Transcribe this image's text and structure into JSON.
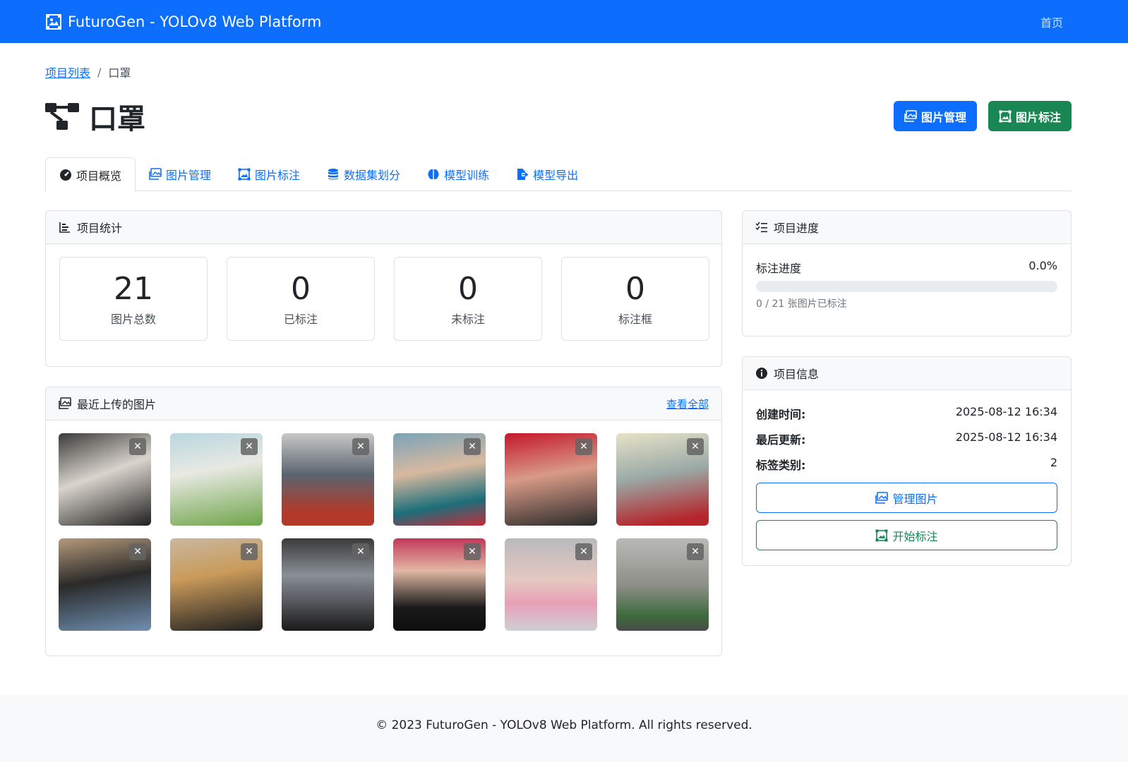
{
  "navbar": {
    "brand": "FuturoGen - YOLOv8 Web Platform",
    "home_link": "首页"
  },
  "breadcrumb": {
    "parent": "项目列表",
    "separator": "/",
    "current": "口罩"
  },
  "page": {
    "title": "口罩"
  },
  "top_buttons": {
    "manage": "图片管理",
    "annotate": "图片标注"
  },
  "tabs": [
    {
      "label": "项目概览",
      "icon": "speedometer-icon"
    },
    {
      "label": "图片管理",
      "icon": "images-icon"
    },
    {
      "label": "图片标注",
      "icon": "bounding-box-icon"
    },
    {
      "label": "数据集划分",
      "icon": "database-icon"
    },
    {
      "label": "模型训练",
      "icon": "brain-icon"
    },
    {
      "label": "模型导出",
      "icon": "export-icon"
    }
  ],
  "stats": {
    "header": "项目统计",
    "items": [
      {
        "value": "21",
        "label": "图片总数"
      },
      {
        "value": "0",
        "label": "已标注"
      },
      {
        "value": "0",
        "label": "未标注"
      },
      {
        "value": "0",
        "label": "标注框"
      }
    ]
  },
  "recent": {
    "header": "最近上传的图片",
    "view_all": "查看全部",
    "close_glyph": "✕",
    "count": 12
  },
  "progress": {
    "header": "项目进度",
    "label": "标注进度",
    "percent_text": "0.0%",
    "fraction": 0,
    "caption": "0 / 21 张图片已标注"
  },
  "info": {
    "header": "项目信息",
    "created_label": "创建时间:",
    "created_value": "2025-08-12 16:34",
    "updated_label": "最后更新:",
    "updated_value": "2025-08-12 16:34",
    "labels_label": "标签类别:",
    "labels_value": "2",
    "manage_button": "管理图片",
    "annotate_button": "开始标注"
  },
  "footer": {
    "text": "© 2023 FuturoGen - YOLOv8 Web Platform. All rights reserved."
  },
  "colors": {
    "primary": "#0d6efd",
    "success": "#198754"
  }
}
